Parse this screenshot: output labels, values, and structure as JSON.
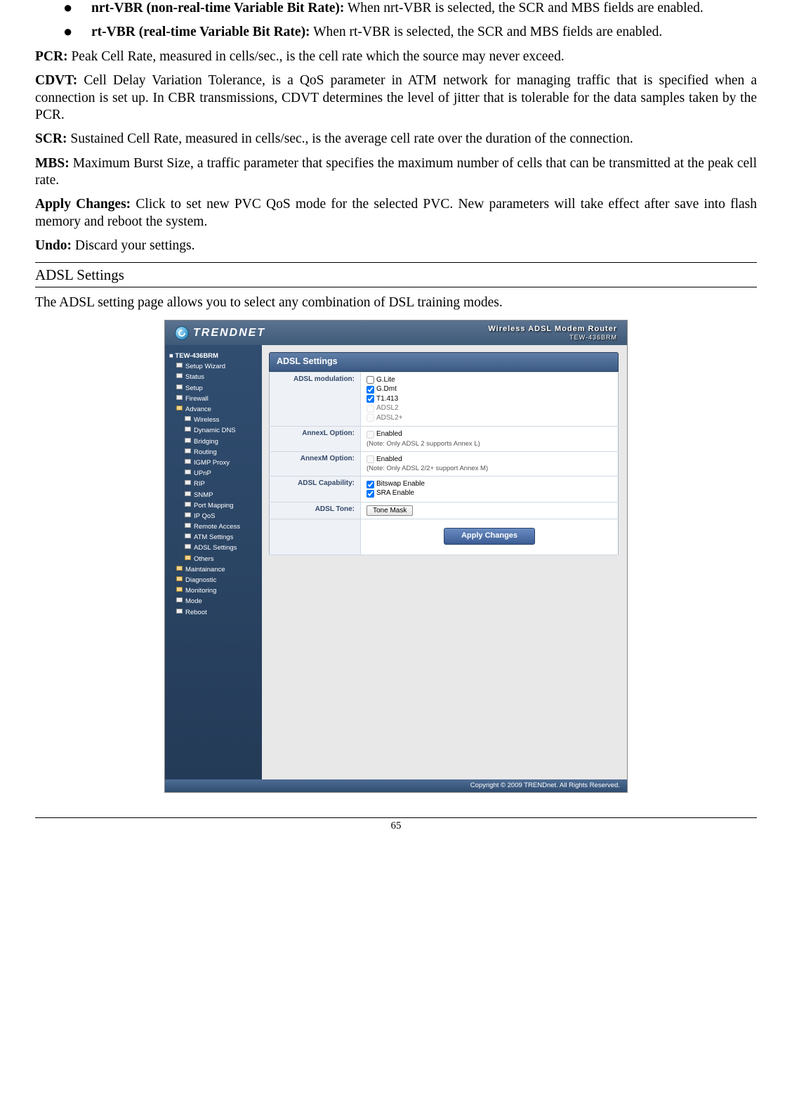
{
  "doc": {
    "b1_head": "nrt-VBR (non-real-time Variable Bit Rate):",
    "b1_text": " When nrt-VBR is selected, the SCR and MBS fields are enabled.",
    "b2_head": "rt-VBR (real-time Variable Bit Rate):",
    "b2_text": " When rt-VBR is selected, the SCR and MBS fields are enabled.",
    "pcr_head": "PCR:",
    "pcr_text": " Peak Cell Rate, measured in cells/sec., is the cell rate which the source may never exceed.",
    "cdvt_head": "CDVT:",
    "cdvt_text": " Cell Delay Variation Tolerance, is a QoS parameter in ATM network for managing traffic that is specified when a connection is set up. In CBR transmissions, CDVT determines the level of jitter that is tolerable for the data samples taken by the PCR.",
    "scr_head": "SCR:",
    "scr_text": " Sustained Cell Rate, measured in cells/sec., is the average cell rate over the duration of the connection.",
    "mbs_head": "MBS:",
    "mbs_text": " Maximum Burst Size, a traffic parameter that specifies the maximum number of cells that can be transmitted at the peak cell rate.",
    "apply_head": "Apply Changes:",
    "apply_text": " Click to set new PVC QoS mode for the selected PVC. New parameters will take effect after save into flash memory and reboot the system.",
    "undo_head": "Undo:",
    "undo_text": " Discard your settings.",
    "section": "ADSL Settings",
    "section_intro": "The ADSL setting page allows you to select any combination of DSL training modes.",
    "page_number": "65"
  },
  "app": {
    "brand": "TRENDNET",
    "sub1": "Wireless ADSL Modem Router",
    "sub2": "TEW-436BRM",
    "panel_title": "ADSL Settings",
    "footer": "Copyright © 2009 TRENDnet. All Rights Reserved.",
    "apply_btn": "Apply Changes",
    "nav": {
      "root": "TEW-436BRM",
      "items": [
        "Setup Wizard",
        "Status",
        "Setup",
        "Firewall",
        "Advance",
        "Wireless",
        "Dynamic DNS",
        "Bridging",
        "Routing",
        "IGMP Proxy",
        "UPnP",
        "RIP",
        "SNMP",
        "Port Mapping",
        "IP QoS",
        "Remote Access",
        "ATM Settings",
        "ADSL Settings",
        "Others",
        "Maintainance",
        "Diagnostic",
        "Monitoring",
        "Mode",
        "Reboot"
      ],
      "sub_start": 5,
      "sub_end": 18
    },
    "labels": {
      "modulation": "ADSL modulation:",
      "annexl": "AnnexL Option:",
      "annexm": "AnnexM Option:",
      "capability": "ADSL Capability:",
      "tone": "ADSL Tone:"
    },
    "opts": {
      "glite": "G.Lite",
      "gdmt": "G.Dmt",
      "t1413": "T1.413",
      "adsl2": "ADSL2",
      "adsl2p": "ADSL2+",
      "enabled": "Enabled",
      "annexl_note": "(Note: Only ADSL 2 supports Annex L)",
      "annexm_note": "(Note: Only ADSL 2/2+ support Annex M)",
      "bitswap": "Bitswap Enable",
      "sra": "SRA Enable",
      "tone_btn": "Tone Mask"
    }
  }
}
